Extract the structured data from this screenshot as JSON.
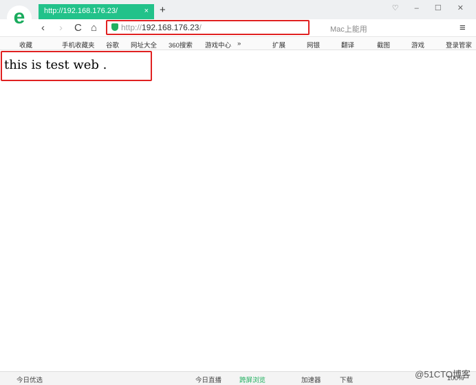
{
  "tab": {
    "title": "http://192.168.176.23/",
    "close": "×",
    "new": "+"
  },
  "window": {
    "controls": "♡ – ☐ ✕"
  },
  "nav": {
    "back": "‹",
    "forward": "›",
    "reload": "C",
    "home": "⌂",
    "url_prefix": "http://",
    "url_host": "192.168.176.23",
    "url_suffix": "/",
    "search_placeholder": "Mac上能用",
    "menu": "≡"
  },
  "bookmarks": [
    "收藏",
    "手机收藏夹",
    "谷歌",
    "网址大全",
    "360搜索",
    "游戏中心",
    "»",
    "扩展",
    "网银",
    "翻译",
    "截图",
    "游戏",
    "登录管家"
  ],
  "page": {
    "text": "this is test web ."
  },
  "status": {
    "left": "今日优选",
    "live": "今日直播",
    "cross": "跨屏浏览",
    "accel": "加速器",
    "download": "下载",
    "zoom": "100%"
  },
  "watermark": "@51CTO博客",
  "colors": {
    "tab": "#22c28a",
    "highlight": "#e02020"
  }
}
